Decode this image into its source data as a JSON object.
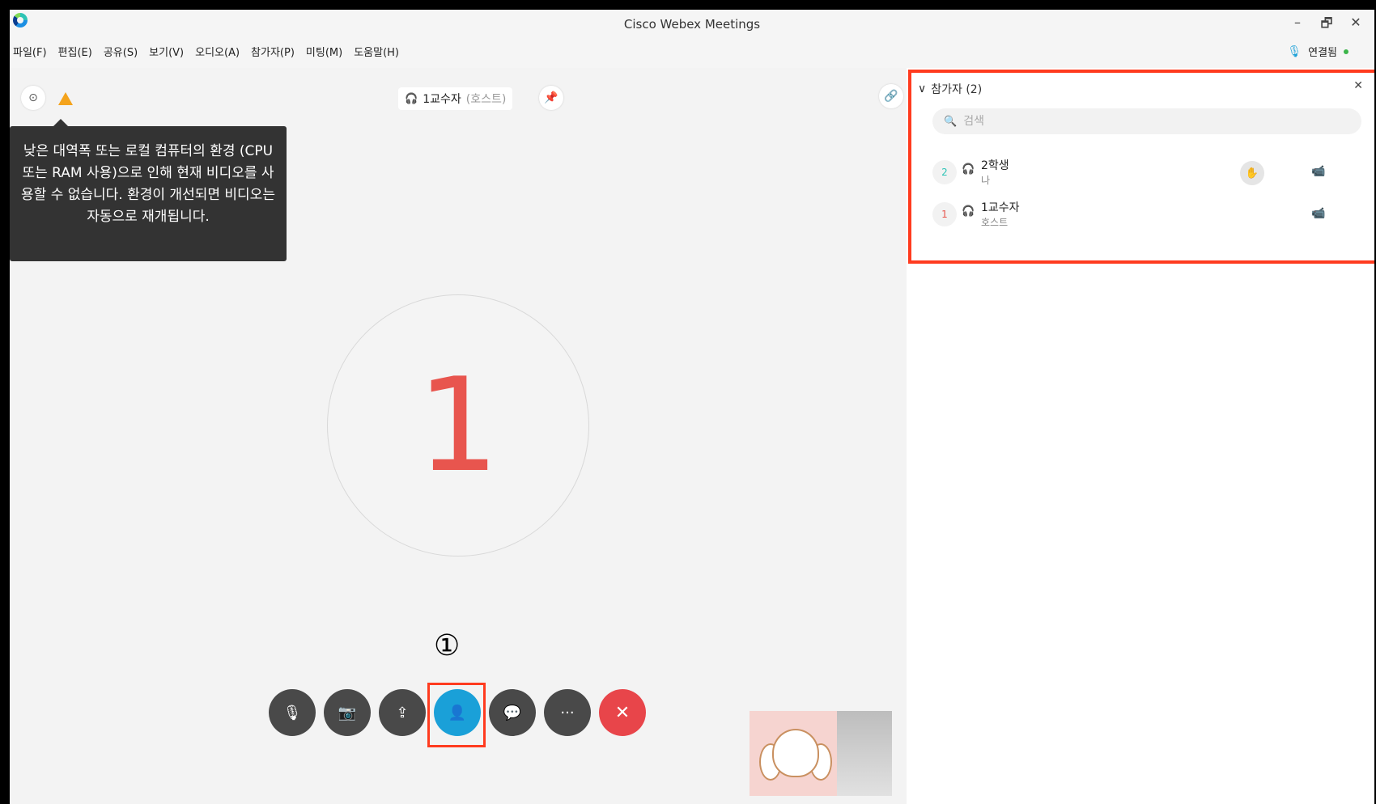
{
  "window": {
    "title": "Cisco Webex Meetings",
    "minimize": "–",
    "restore": "🗗",
    "close": "✕"
  },
  "menu": [
    "파일(F)",
    "편집(E)",
    "공유(S)",
    "보기(V)",
    "오디오(A)",
    "참가자(P)",
    "미팅(M)",
    "도움말(H)"
  ],
  "connection": {
    "mic_icon": "🎙",
    "label": "연결됨"
  },
  "stage": {
    "info_icon": "⊙",
    "warning_text": "낮은 대역폭 또는 로컬 컴퓨터의 환경 (CPU 또는 RAM 사용)으로 인해 현재 비디오를 사용할 수 없습니다. 환경이 개선되면 비디오는 자동으로 재개됩니다.",
    "active_speaker": {
      "audio_icon": "🎧",
      "name": "1교수자",
      "role": "(호스트)"
    },
    "pin_icon": "📌",
    "link_icon": "🔗",
    "avatar_initial": "1",
    "annotation": "①"
  },
  "controls": {
    "mute": "🎙",
    "video": "📷",
    "share": "⇪",
    "participants": "👤",
    "chat": "💬",
    "more": "···",
    "leave": "✕"
  },
  "panel": {
    "header_chevron": "∨",
    "title": "참가자 (2)",
    "close": "✕",
    "search_icon": "🔍",
    "search_placeholder": "검색",
    "participants": [
      {
        "num": "2",
        "audio_icon": "🎧",
        "name": "2학생",
        "sub": "나",
        "hand_icon": "✋",
        "cam_icon": "📹",
        "accent": "#f4a31c"
      },
      {
        "num": "1",
        "audio_icon": "🎧",
        "name": "1교수자",
        "sub": "호스트",
        "cam_icon": "📹",
        "accent": "#e8554e"
      }
    ]
  },
  "colors": {
    "highlight": "#ff3b1f",
    "accent_blue": "#1aa0d8",
    "leave_red": "#e8454a"
  }
}
